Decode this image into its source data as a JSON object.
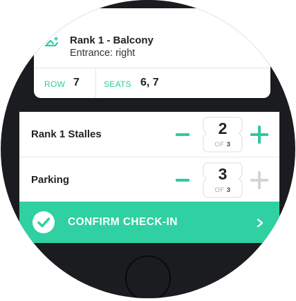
{
  "ticket": {
    "icon": "seat-icon",
    "title": "Rank 1 - Balcony",
    "subtitle": "Entrance: right",
    "row_label": "ROW",
    "row_value": "7",
    "seats_label": "SEATS",
    "seats_value": "6, 7"
  },
  "items": [
    {
      "label": "Rank 1 Stalles",
      "count": "2",
      "of_label": "OF",
      "max": "3",
      "plus_enabled": true
    },
    {
      "label": "Parking",
      "count": "3",
      "of_label": "OF",
      "max": "3",
      "plus_enabled": false
    }
  ],
  "confirm": {
    "label": "CONFIRM CHECK-IN",
    "icon": "check-circle-icon",
    "chevron": "chevron-right-icon"
  },
  "colors": {
    "accent": "#2fd0a1",
    "dark_bezel": "#1b1c20",
    "disabled": "#d4d4d4"
  }
}
